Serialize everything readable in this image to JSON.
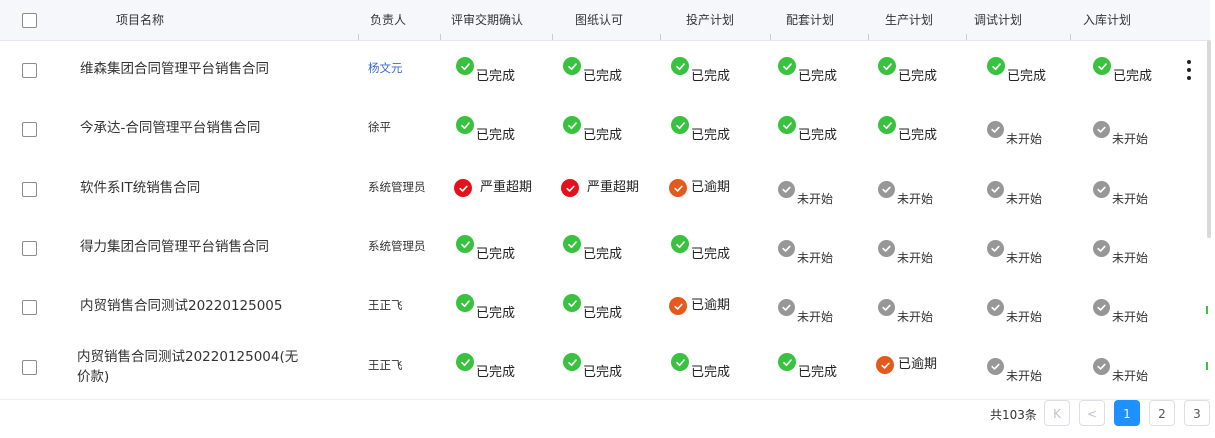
{
  "table": {
    "columns": {
      "name": "项目名称",
      "owner": "负责人",
      "c1": "评审交期确认",
      "c2": "图纸认可",
      "c3": "投产计划",
      "c4": "配套计划",
      "c5": "生产计划",
      "c6": "调试计划",
      "c7": "入库计划"
    },
    "rows": [
      {
        "name_l1": "维森集团合同管理平台销售合同",
        "name_l2": "",
        "owner": "杨文元",
        "s": [
          "已完成",
          "已完成",
          "已完成",
          "已完成",
          "已完成",
          "已完成",
          "已完成"
        ],
        "t": [
          "done",
          "done",
          "done",
          "done",
          "done",
          "done",
          "done"
        ]
      },
      {
        "name_l1": "今承达-合同管理平台销售合同",
        "name_l2": "",
        "owner": "徐平",
        "s": [
          "已完成",
          "已完成",
          "已完成",
          "已完成",
          "已完成",
          "未开始",
          "未开始"
        ],
        "t": [
          "done",
          "done",
          "done",
          "done",
          "done",
          "not",
          "not"
        ]
      },
      {
        "name_l1": "软件系IT统销售合同",
        "name_l2": "",
        "owner": "系统管理员",
        "s": [
          "严重超期",
          "严重超期",
          "已逾期",
          "未开始",
          "未开始",
          "未开始",
          "未开始"
        ],
        "t": [
          "severe",
          "severe",
          "over",
          "not",
          "not",
          "not",
          "not"
        ]
      },
      {
        "name_l1": "得力集团合同管理平台销售合同",
        "name_l2": "",
        "owner": "系统管理员",
        "s": [
          "已完成",
          "已完成",
          "已完成",
          "未开始",
          "未开始",
          "未开始",
          "未开始"
        ],
        "t": [
          "done",
          "done",
          "done",
          "not",
          "not",
          "not",
          "not"
        ]
      },
      {
        "name_l1": "内贸销售合同测试20220125005",
        "name_l2": "",
        "owner": "王正飞",
        "s": [
          "已完成",
          "已完成",
          "已逾期",
          "未开始",
          "未开始",
          "未开始",
          "未开始"
        ],
        "t": [
          "done",
          "done",
          "over",
          "not",
          "not",
          "not",
          "not"
        ]
      },
      {
        "name_l1": "内贸销售合同测试20220125004(无",
        "name_l2": "价款)",
        "owner": "王正飞",
        "s": [
          "已完成",
          "已完成",
          "已完成",
          "已完成",
          "已逾期",
          "未开始",
          "未开始"
        ],
        "t": [
          "done",
          "done",
          "done",
          "done",
          "over",
          "not",
          "not"
        ]
      }
    ]
  },
  "pagination": {
    "total": "共103条",
    "first": "K",
    "prev": "<",
    "pages": [
      "1",
      "2",
      "3"
    ],
    "current": "1"
  },
  "colors": {
    "done": "#39c23f",
    "not_started": "#979797",
    "overdue": "#e55a1c",
    "severe": "#e5101b",
    "accent": "#1e90ff",
    "owner_link": "#3a6bd1"
  }
}
